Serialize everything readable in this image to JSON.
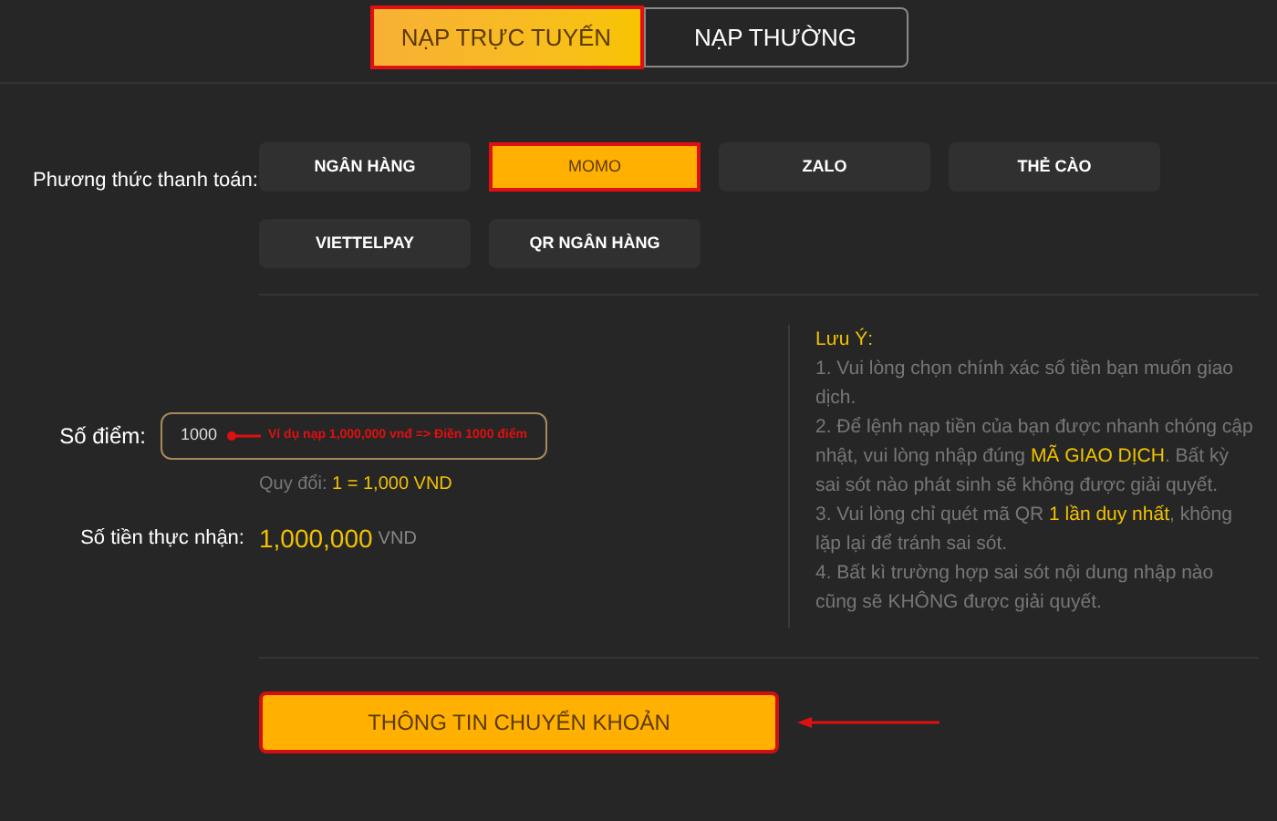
{
  "tabs": [
    {
      "label": "NẠP TRỰC TUYẾN",
      "selected": true
    },
    {
      "label": "NẠP THƯỜNG",
      "selected": false
    }
  ],
  "payment": {
    "label": "Phương thức thanh toán:",
    "methods": [
      {
        "label": "NGÂN HÀNG",
        "selected": false
      },
      {
        "label": "MOMO",
        "selected": true
      },
      {
        "label": "ZALO",
        "selected": false
      },
      {
        "label": "THẺ CÀO",
        "selected": false
      },
      {
        "label": "VIETTELPAY",
        "selected": false
      },
      {
        "label": "QR NGÂN HÀNG",
        "selected": false
      }
    ]
  },
  "form": {
    "points_label": "Số điểm:",
    "points_value": "1000",
    "annotation": "Ví dụ nạp 1,000,000 vnđ => Điền 1000 điểm",
    "rate_label": "Quy đổi:",
    "rate_value": "1 = 1,000 VND",
    "received_label": "Số tiền thực nhận:",
    "received_amount": "1,000,000",
    "received_unit": "VND"
  },
  "notes": {
    "title": "Lưu Ý:",
    "items": [
      "1. Vui lòng chọn chính xác số tiền bạn muốn giao dịch.",
      "2. Để lệnh nạp tiền của bạn được nhanh chóng cập nhật, vui lòng nhập đúng **MÃ GIAO DỊCH**. Bất kỳ sai sót nào phát sinh sẽ không được giải quyết.",
      "3. Vui lòng chỉ quét mã QR **1 lần duy nhất**, không lặp lại để tránh sai sót.",
      "4. Bất kì trường hợp sai sót nội dung nhập nào cũng sẽ KHÔNG được giải quyết."
    ]
  },
  "submit": {
    "label": "THÔNG TIN CHUYỂN KHOẢN"
  }
}
